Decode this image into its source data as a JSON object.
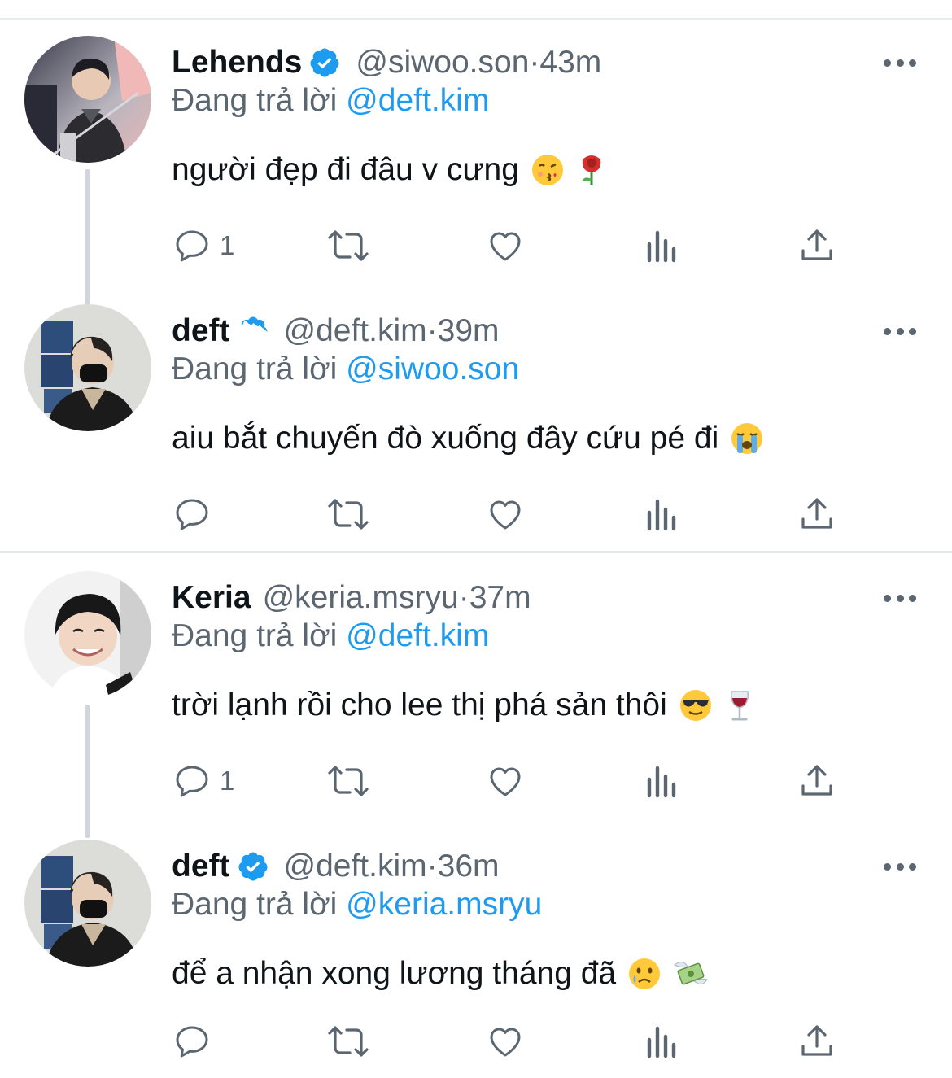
{
  "threads": [
    {
      "tweets": [
        {
          "name": "Lehends",
          "verified": true,
          "handle": "@siwoo.son",
          "time": "43m",
          "reply_prefix": "Đang trả lời",
          "reply_mention": "@deft.kim",
          "text": "người đẹp đi đâu v cưng",
          "emojis": [
            "kissing-face-emoji",
            "rose-emoji"
          ],
          "reply_count": "1"
        },
        {
          "name": "deft",
          "verified": true,
          "handle": "@deft.kim",
          "time": "39m",
          "reply_prefix": "Đang trả lời",
          "reply_mention": "@siwoo.son",
          "text": "aiu bắt chuyến đò xuống đây cứu pé đi",
          "emojis": [
            "loudly-crying-face-emoji"
          ],
          "reply_count": ""
        }
      ]
    },
    {
      "tweets": [
        {
          "name": "Keria",
          "verified": false,
          "handle": "@keria.msryu",
          "time": "37m",
          "reply_prefix": "Đang trả lời",
          "reply_mention": "@deft.kim",
          "text": "trời lạnh rồi cho lee thị phá sản thôi",
          "emojis": [
            "sunglasses-face-emoji",
            "wine-glass-emoji"
          ],
          "reply_count": "1"
        },
        {
          "name": "deft",
          "verified": true,
          "handle": "@deft.kim",
          "time": "36m",
          "reply_prefix": "Đang trả lời",
          "reply_mention": "@keria.msryu",
          "text": "để a nhận xong lương tháng đã",
          "emojis": [
            "crying-face-emoji",
            "money-with-wings-emoji"
          ],
          "reply_count": ""
        }
      ]
    }
  ],
  "separator": "·",
  "icons": [
    "reply-icon",
    "retweet-icon",
    "like-icon",
    "analytics-icon",
    "share-icon",
    "more-icon",
    "verified-badge-icon"
  ],
  "colors": {
    "accent": "#1d9bf0",
    "secondary_text": "#5b6670",
    "primary_text": "#0f1419",
    "thread_line": "#d0d6db"
  }
}
